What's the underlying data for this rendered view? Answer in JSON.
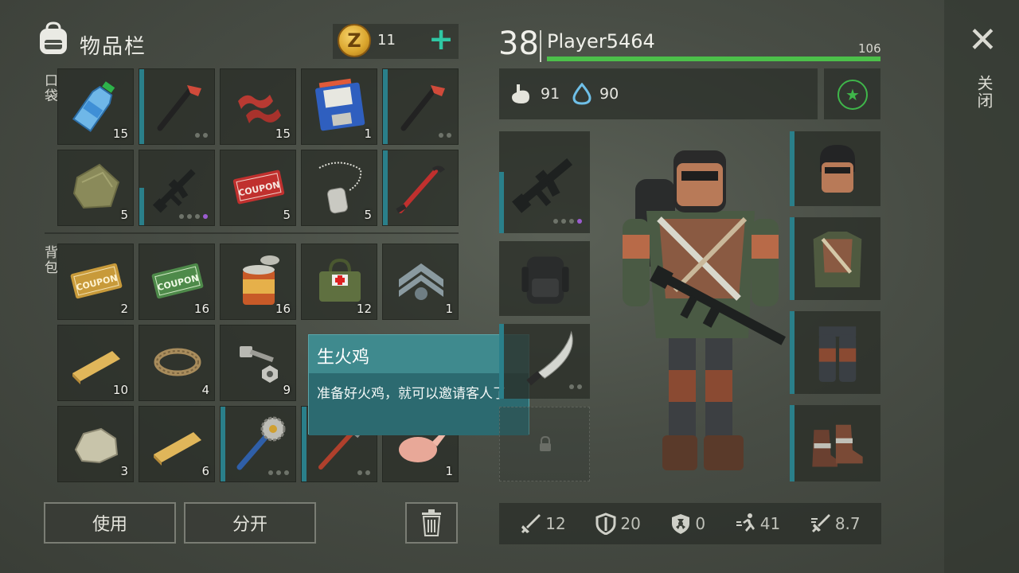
{
  "inventory": {
    "title": "物品栏",
    "coins": "11",
    "coin_symbol": "Z",
    "add_symbol": "+",
    "pocket_label": "口袋",
    "backpack_label": "背包",
    "pocket_items": [
      {
        "icon": "water-bottle-icon",
        "qty": "15"
      },
      {
        "icon": "crowbar-icon",
        "qty": ""
      },
      {
        "icon": "bacon-icon",
        "qty": "15"
      },
      {
        "icon": "floppy-disk-icon",
        "qty": "1"
      },
      {
        "icon": "crowbar-icon",
        "qty": ""
      },
      {
        "icon": "cloth-rag-icon",
        "qty": "5"
      },
      {
        "icon": "assault-rifle-icon",
        "qty": ""
      },
      {
        "icon": "combat-gear-coupon-icon",
        "qty": "5",
        "coupon_text": "COUPON"
      },
      {
        "icon": "dog-tag-icon",
        "qty": "5"
      },
      {
        "icon": "red-crowbar-icon",
        "qty": ""
      }
    ],
    "backpack_items": [
      {
        "icon": "survival-kit-coupon-icon",
        "qty": "2",
        "coupon_text": "COUPON"
      },
      {
        "icon": "ration-coupon-icon",
        "qty": "16",
        "coupon_text": "COUPON"
      },
      {
        "icon": "tin-can-icon",
        "qty": "16"
      },
      {
        "icon": "first-aid-bag-icon",
        "qty": "12"
      },
      {
        "icon": "sergeant-chevron-icon",
        "qty": "1"
      },
      {
        "icon": "wood-plank-icon",
        "qty": "10"
      },
      {
        "icon": "rope-icon",
        "qty": "4"
      },
      {
        "icon": "bolt-nut-icon",
        "qty": "9"
      },
      {
        "icon": "wood-plank-icon",
        "qty": "6"
      },
      {
        "icon": "stone-icon",
        "qty": "3"
      },
      {
        "icon": "saw-mace-icon",
        "qty": ""
      },
      {
        "icon": "hammer-icon",
        "qty": ""
      },
      {
        "icon": "raw-chicken-icon",
        "qty": "1"
      }
    ]
  },
  "tooltip": {
    "title": "生火鸡",
    "description": "准备好火鸡，就可以邀请客人了"
  },
  "actions": {
    "use_label": "使用",
    "split_label": "分开",
    "trash_icon": "trash-icon"
  },
  "player": {
    "level": "38",
    "name": "Player5464",
    "xp_value": "106",
    "xp_fraction": 1.0,
    "food": "91",
    "water": "90",
    "accent_color": "#4cc04a",
    "teal_color": "#2a7f8a"
  },
  "equipment": {
    "weapon": "assault-rifle-icon",
    "backpack": "backpack-icon",
    "melee": "machete-icon",
    "locked": "lock-icon",
    "helmet": "welding-mask-icon",
    "vest": "armor-vest-icon",
    "pants": "armored-pants-icon",
    "boots": "boots-icon"
  },
  "stats": {
    "attack": "12",
    "defense": "20",
    "radiation": "0",
    "speed": "41",
    "attack_speed": "8.7"
  },
  "close": {
    "label": "关闭",
    "symbol": "✕"
  }
}
